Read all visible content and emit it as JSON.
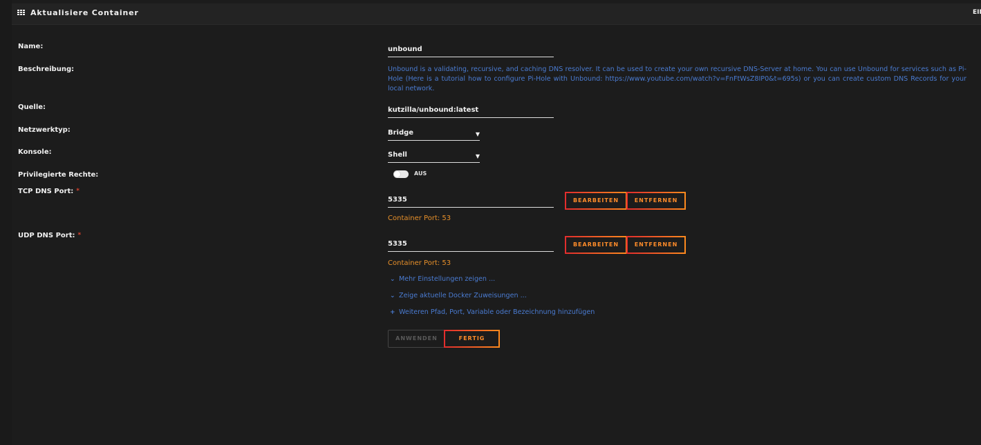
{
  "window": {
    "title": "Aktualisiere Container",
    "right_label": "EINFACHE ANSICHT"
  },
  "form": {
    "name": {
      "label": "Name:",
      "value": "unbound"
    },
    "description": {
      "label": "Beschreibung:",
      "text": "Unbound is a validating, recursive, and caching DNS resolver. It can be used to create your own recursive DNS-Server at home. You can use Unbound for services such as Pi-Hole (Here is a tutorial how to configure Pi-Hole with Unbound: https://www.youtube.com/watch?v=FnFtWsZ8IP0&t=695s) or you can create custom DNS Records for your local network."
    },
    "source": {
      "label": "Quelle:",
      "value": "kutzilla/unbound:latest"
    },
    "network": {
      "label": "Netzwerktyp:",
      "value": "Bridge"
    },
    "console": {
      "label": "Konsole:",
      "value": "Shell"
    },
    "privileged": {
      "label": "Privilegierte Rechte:",
      "state": "AUS"
    },
    "tcp_port": {
      "label": "TCP DNS Port:",
      "required": "*",
      "value": "5335",
      "hint": "Container Port: 53"
    },
    "udp_port": {
      "label": "UDP DNS Port:",
      "required": "*",
      "value": "5335",
      "hint": "Container Port: 53"
    },
    "buttons": {
      "edit": "BEARBEITEN",
      "remove": "ENTFERNEN",
      "apply": "ANWENDEN",
      "done": "FERTIG"
    },
    "links": {
      "more_settings": "Mehr Einstellungen zeigen ...",
      "docker_mappings": "Zeige aktuelle Docker Zuweisungen ...",
      "add_more": "Weiteren Pfad, Port, Variable oder Bezeichnung hinzufügen"
    }
  },
  "colors": {
    "accent_orange": "#ff8c2a",
    "accent_red": "#e22d2d",
    "link_blue": "#4a7bd1",
    "background": "#1c1c1c"
  },
  "icons": {
    "title": "grid-icon",
    "select": "caret-down-icon",
    "expand": "chevron-down-icon",
    "add": "plus-icon"
  }
}
